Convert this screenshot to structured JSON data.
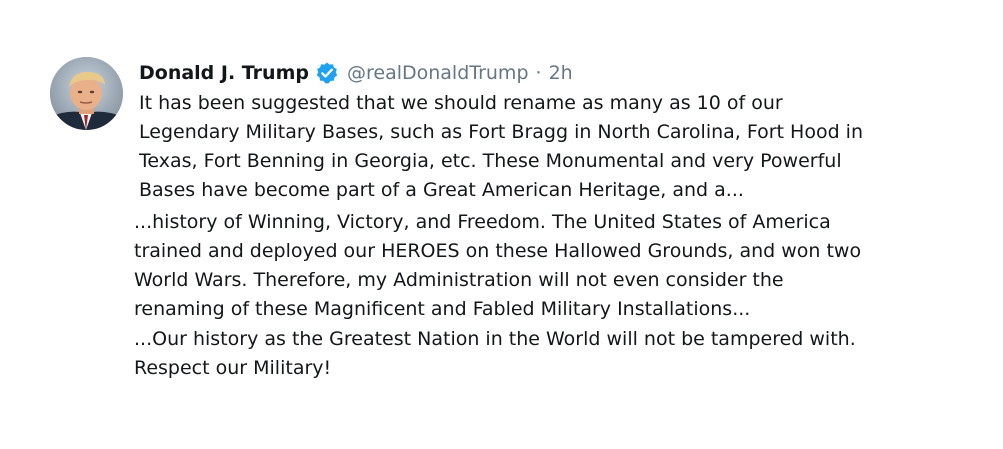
{
  "tweet": {
    "author_name": "Donald J. Trump",
    "handle": "@realDonaldTrump",
    "separator": "·",
    "time": "2h",
    "verified_icon": "verified-badge-icon",
    "colors": {
      "text": "#14171a",
      "secondary_text": "#657786",
      "verified": "#1da1f2"
    },
    "paragraphs": [
      "It has been suggested that we should rename as many as 10 of our\nLegendary Military Bases, such as Fort Bragg in North Carolina, Fort Hood in\nTexas, Fort Benning in Georgia, etc. These Monumental and very Powerful\nBases have become part of a Great American Heritage, and a...",
      "...history of Winning, Victory, and Freedom. The United States of America\ntrained and deployed our HEROES on these Hallowed Grounds, and won two\nWorld Wars. Therefore, my Administration will not even consider the\nrenaming of these Magnificent and Fabled Military Installations...",
      "...Our history as the Greatest Nation in the World will not be tampered with.\nRespect our Military!"
    ]
  }
}
